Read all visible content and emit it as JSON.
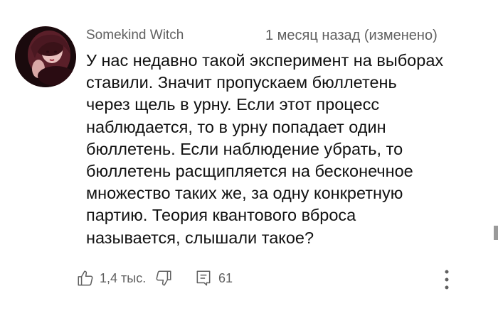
{
  "comment": {
    "author": "Somekind Witch",
    "timestamp": "1 месяц назад (изменено)",
    "text_lines": [
      "У нас недавно такой эксперимент на выборах",
      "ставили. Значит пропускаем бюллетень",
      "через щель в урну. Если этот процесс",
      "наблюдается, то в урну попадает один",
      "бюллетень. Если наблюдение убрать, то",
      "бюллетень расщипляется на бесконечное",
      "множество таких же, за одну конкретную",
      "партию. Теория квантового вброса",
      "называется, слышали такое?"
    ]
  },
  "actions": {
    "like_icon": "thumbs-up-icon",
    "like_count": "1,4 тыс.",
    "dislike_icon": "thumbs-down-icon",
    "reply_icon": "comment-icon",
    "reply_count": "61",
    "more_icon": "more-vertical-icon"
  },
  "colors": {
    "text": "#111111",
    "secondary": "#606060",
    "background": "#ffffff"
  }
}
